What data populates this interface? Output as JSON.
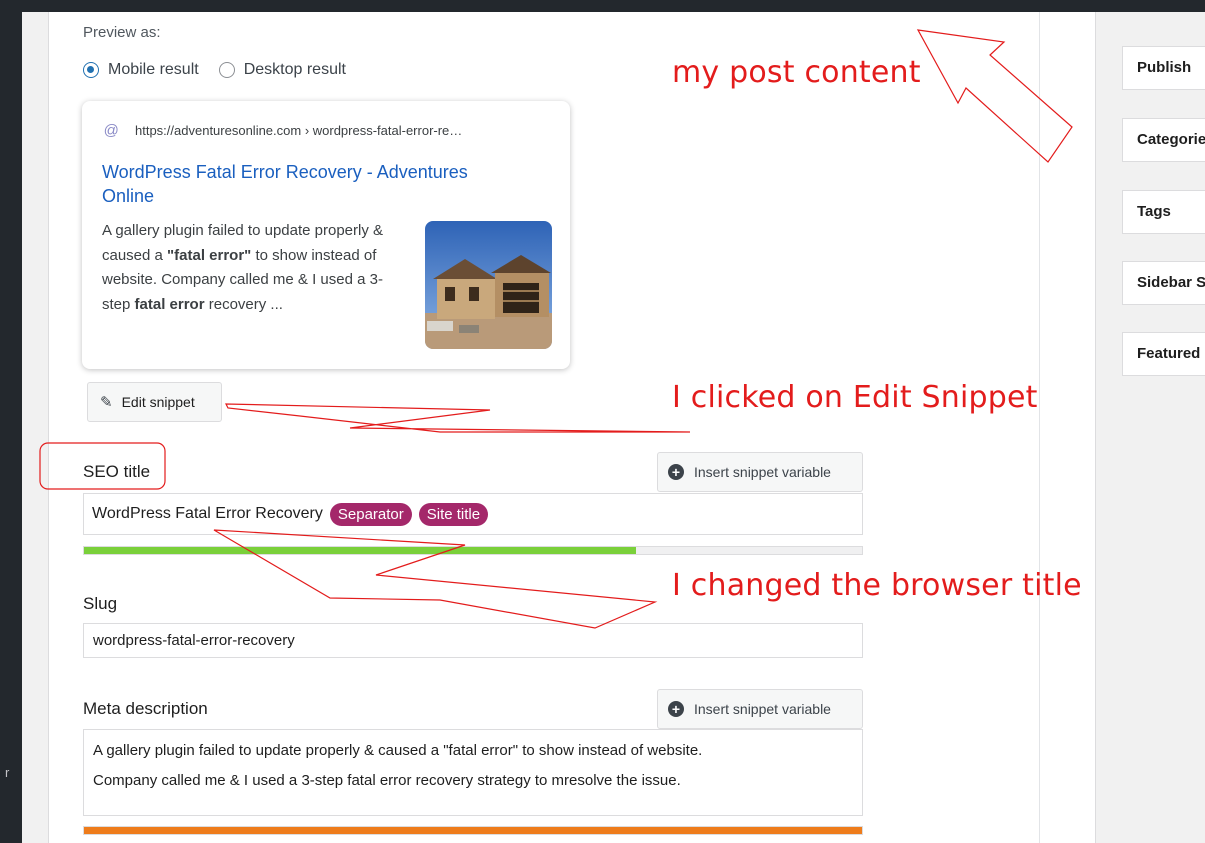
{
  "preview": {
    "label": "Preview as:",
    "options": [
      "Mobile result",
      "Desktop result"
    ],
    "selected": "Mobile result"
  },
  "snippet_card": {
    "favicon": "@",
    "url": "https://adventuresonline.com › wordpress-fatal-error-re…",
    "title": "WordPress Fatal Error Recovery - Adventures Online",
    "desc_parts": [
      "A gallery plugin failed to update properly & caused a ",
      "\"fatal error\"",
      " to show instead of website. Company called me & I used a 3-step ",
      "fatal error",
      " recovery ..."
    ]
  },
  "edit_snippet": {
    "label": "Edit snippet",
    "icon": "pencil-icon"
  },
  "seo_title": {
    "label": "SEO title",
    "insert_label": "Insert snippet variable",
    "text": "WordPress Fatal Error Recovery",
    "pills": [
      "Separator",
      "Site title"
    ],
    "progress": 0.71,
    "progress_color": "#7ad03a"
  },
  "slug": {
    "label": "Slug",
    "value": "wordpress-fatal-error-recovery"
  },
  "meta_description": {
    "label": "Meta description",
    "insert_label": "Insert snippet variable",
    "line1": "A gallery plugin failed to update properly & caused a \"fatal error\" to show instead of website.",
    "line2": "Company called me & I used a 3-step fatal error recovery strategy to mresolve the issue.",
    "progress": 1.0,
    "progress_color": "#ee7c1b"
  },
  "sidebar": {
    "items": [
      "Publish",
      "Categories",
      "Tags",
      "Sidebar Settings",
      "Featured image"
    ]
  },
  "annotations": {
    "post_content": "my post content",
    "edit_snippet": "I clicked on Edit Snippet",
    "browser_title": "I changed the browser title",
    "color": "#e31c1c"
  },
  "colors": {
    "link": "#1a5fbf",
    "pill": "#a4286a",
    "radio": "#2271b1"
  }
}
